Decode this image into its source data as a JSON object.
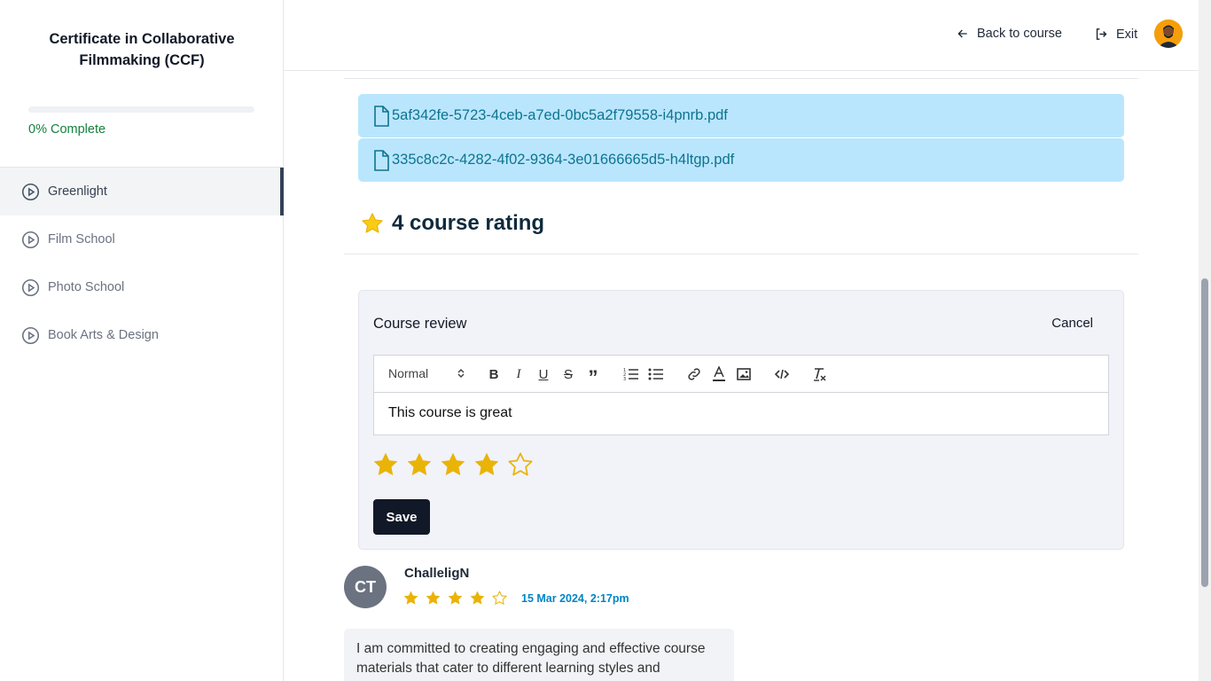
{
  "sidebar": {
    "course_title": "Certificate in Collaborative Filmmaking (CCF)",
    "progress_percent": 0,
    "progress_text": "0% Complete",
    "items": [
      {
        "label": "Greenlight",
        "active": true
      },
      {
        "label": "Film School",
        "active": false
      },
      {
        "label": "Photo School",
        "active": false
      },
      {
        "label": "Book Arts & Design",
        "active": false
      }
    ]
  },
  "header": {
    "back_label": "Back to course",
    "exit_label": "Exit"
  },
  "attachments": [
    {
      "name": "5af342fe-5723-4ceb-a7ed-0bc5a2f79558-i4pnrb.pdf"
    },
    {
      "name": "335c8c2c-4282-4f02-9364-3e01666665d5-h4ltgp.pdf"
    }
  ],
  "rating": {
    "heading": "4 course rating",
    "value": 4
  },
  "review_form": {
    "title": "Course review",
    "cancel_label": "Cancel",
    "format_select": "Normal",
    "text": "This course is great",
    "stars": 4,
    "max_stars": 5,
    "save_label": "Save"
  },
  "reviews": [
    {
      "initials": "CT",
      "name": "ChalleligN",
      "stars": 4,
      "date": "15 Mar 2024, 2:17pm",
      "body": "I am committed to creating engaging and effective course materials that cater to different learning styles and"
    }
  ],
  "colors": {
    "star": "#eab308",
    "accent_dark": "#111827",
    "attachment_bg": "#bae6fd",
    "date": "#0284c7"
  }
}
